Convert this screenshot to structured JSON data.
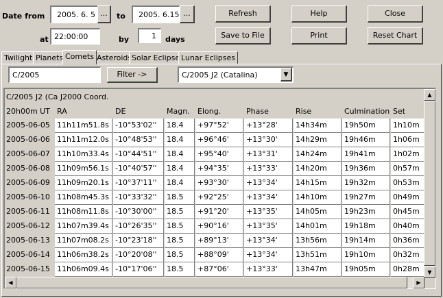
{
  "header": {
    "date_from_label": "Date from",
    "date_from_value": "2005. 6. 5",
    "to_label": "to",
    "date_to_value": "2005. 6.15",
    "picker_label": "...",
    "at_label": "at",
    "time_value": "22:00:00",
    "by_label": "by",
    "step_value": "1",
    "days_label": "days"
  },
  "buttons": {
    "refresh": "Refresh",
    "help": "Help",
    "close": "Close",
    "save_to_file": "Save to File",
    "print": "Print",
    "reset_chart": "Reset Chart"
  },
  "tabs": [
    {
      "label": "Twilight"
    },
    {
      "label": "Planets"
    },
    {
      "label": "Comets",
      "active": true
    },
    {
      "label": "Asteroids"
    },
    {
      "label": "Solar Eclipses"
    },
    {
      "label": "Lunar Eclipses"
    }
  ],
  "filter": {
    "search_value": "C/2005",
    "filter_button": "Filter ->",
    "selected_comet": "C/2005 J2 (Catalina)"
  },
  "table": {
    "title": "C/2005 J2 (Ca J2000 Coord.",
    "columns": [
      "20h00m UT",
      "RA",
      "DE",
      "Magn.",
      "Elong.",
      "Phase",
      "Rise",
      "Culmination",
      "Set"
    ],
    "rows": [
      [
        "2005-06-05",
        "11h11m51.8s",
        "-10°53'02''",
        "18.4",
        "+97°52'",
        "+13°28'",
        "14h34m",
        "19h50m",
        "1h10m"
      ],
      [
        "2005-06-06",
        "11h11m12.0s",
        "-10°48'53''",
        "18.4",
        "+96°46'",
        "+13°30'",
        "14h29m",
        "19h46m",
        "1h06m"
      ],
      [
        "2005-06-07",
        "11h10m33.4s",
        "-10°44'51''",
        "18.4",
        "+95°40'",
        "+13°31'",
        "14h24m",
        "19h41m",
        "1h02m"
      ],
      [
        "2005-06-08",
        "11h09m56.1s",
        "-10°40'57''",
        "18.4",
        "+94°35'",
        "+13°33'",
        "14h20m",
        "19h36m",
        "0h57m"
      ],
      [
        "2005-06-09",
        "11h09m20.1s",
        "-10°37'11''",
        "18.4",
        "+93°30'",
        "+13°34'",
        "14h15m",
        "19h32m",
        "0h53m"
      ],
      [
        "2005-06-10",
        "11h08m45.3s",
        "-10°33'32''",
        "18.5",
        "+92°25'",
        "+13°34'",
        "14h10m",
        "19h27m",
        "0h49m"
      ],
      [
        "2005-06-11",
        "11h08m11.8s",
        "-10°30'00''",
        "18.5",
        "+91°20'",
        "+13°35'",
        "14h05m",
        "19h23m",
        "0h45m"
      ],
      [
        "2005-06-12",
        "11h07m39.4s",
        "-10°26'35''",
        "18.5",
        "+90°16'",
        "+13°35'",
        "14h01m",
        "19h18m",
        "0h40m"
      ],
      [
        "2005-06-13",
        "11h07m08.2s",
        "-10°23'18''",
        "18.5",
        "+89°13'",
        "+13°34'",
        "13h56m",
        "19h14m",
        "0h36m"
      ],
      [
        "2005-06-14",
        "11h06m38.2s",
        "-10°20'08''",
        "18.5",
        "+88°09'",
        "+13°34'",
        "13h51m",
        "19h10m",
        "0h32m"
      ],
      [
        "2005-06-15",
        "11h06m09.4s",
        "-10°17'06''",
        "18.5",
        "+87°06'",
        "+13°33'",
        "13h47m",
        "19h05m",
        "0h28m"
      ]
    ]
  },
  "icons": {
    "scroll_up": "arrow-up-icon",
    "scroll_down": "arrow-down-icon",
    "scroll_left": "arrow-left-icon",
    "scroll_right": "arrow-right-icon",
    "dropdown": "dropdown-arrow-icon"
  }
}
